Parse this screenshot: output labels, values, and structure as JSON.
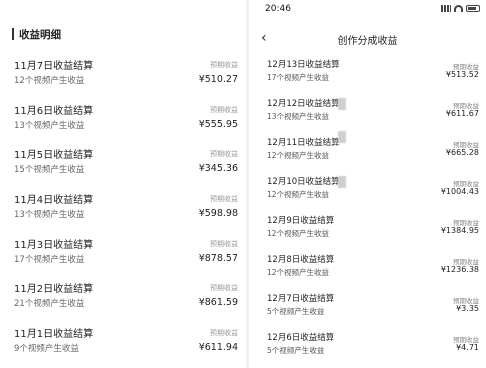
{
  "left": {
    "title": "收益明细",
    "expected_label": "预期收益",
    "rows": [
      {
        "date": "11月7日收益结算",
        "videos": "12个视频产生收益",
        "amount": "¥510.27"
      },
      {
        "date": "11月6日收益结算",
        "videos": "13个视频产生收益",
        "amount": "¥555.95"
      },
      {
        "date": "11月5日收益结算",
        "videos": "15个视频产生收益",
        "amount": "¥345.36"
      },
      {
        "date": "11月4日收益结算",
        "videos": "13个视频产生收益",
        "amount": "¥598.98"
      },
      {
        "date": "11月3日收益结算",
        "videos": "17个视频产生收益",
        "amount": "¥878.57"
      },
      {
        "date": "11月2日收益结算",
        "videos": "21个视频产生收益",
        "amount": "¥861.59"
      },
      {
        "date": "11月1日收益结算",
        "videos": "9个视频产生收益",
        "amount": "¥611.94"
      }
    ]
  },
  "right": {
    "status_time": "20:46",
    "nav_title": "创作分成收益",
    "back_icon": "‹",
    "expected_label": "预期收益",
    "rows": [
      {
        "date": "12月13日收益结算",
        "videos": "17个视频产生收益",
        "amount": "¥513.52"
      },
      {
        "date": "12月12日收益结算",
        "videos": "13个视频产生收益",
        "amount": "¥611.67"
      },
      {
        "date": "12月11日收益结算",
        "videos": "12个视频产生收益",
        "amount": "¥665.28"
      },
      {
        "date": "12月10日收益结算",
        "videos": "12个视频产生收益",
        "amount": "¥1004.43"
      },
      {
        "date": "12月9日收益结算",
        "videos": "12个视频产生收益",
        "amount": "¥1384.95"
      },
      {
        "date": "12月8日收益结算",
        "videos": "12个视频产生收益",
        "amount": "¥1236.38"
      },
      {
        "date": "12月7日收益结算",
        "videos": "5个视频产生收益",
        "amount": "¥3.35"
      },
      {
        "date": "12月6日收益结算",
        "videos": "5个视频产生收益",
        "amount": "¥4.71"
      }
    ]
  }
}
